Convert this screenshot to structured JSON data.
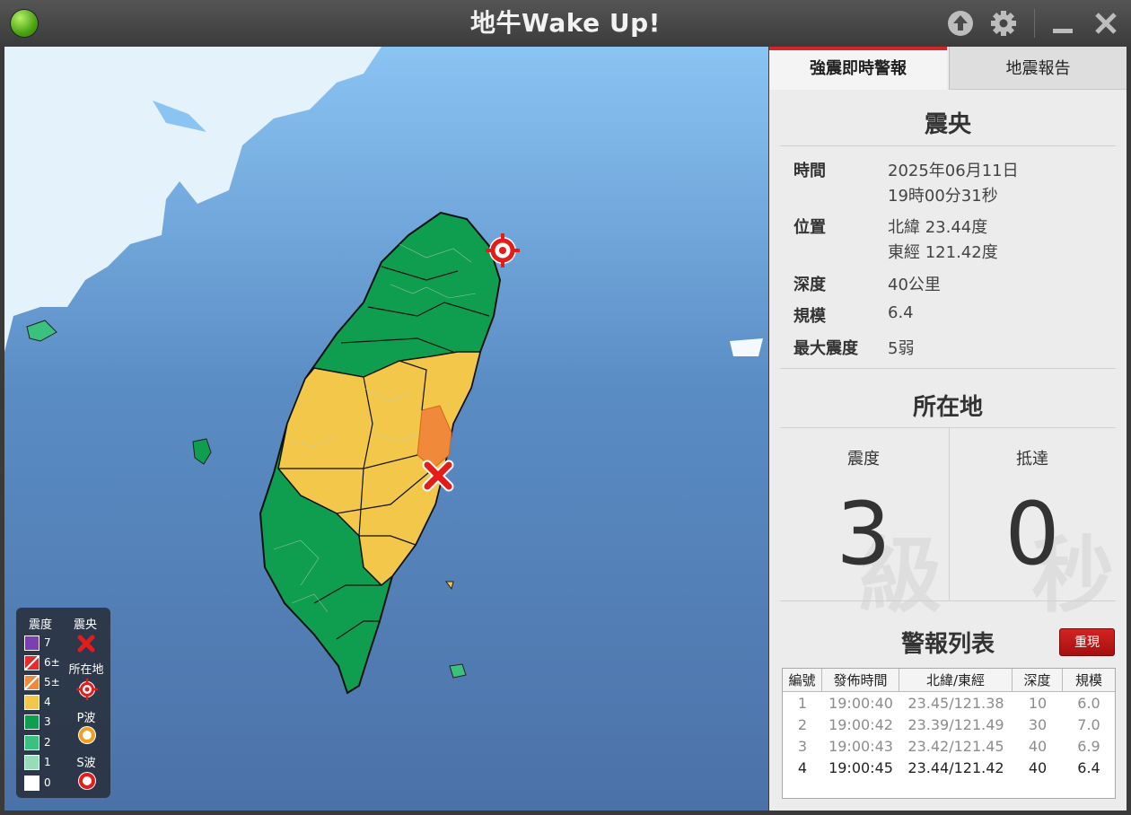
{
  "window": {
    "title": "地牛Wake Up!"
  },
  "tabs": [
    {
      "label": "強震即時警報"
    },
    {
      "label": "地震報告"
    }
  ],
  "epicenter": {
    "title": "震央",
    "time_label": "時間",
    "time_line1": "2025年06月11日",
    "time_line2": "19時00分31秒",
    "location_label": "位置",
    "lat": "北緯 23.44度",
    "lon": "東經 121.42度",
    "depth_label": "深度",
    "depth": "40公里",
    "magnitude_label": "規模",
    "magnitude": "6.4",
    "max_intensity_label": "最大震度",
    "max_intensity": "5弱"
  },
  "local": {
    "title": "所在地",
    "intensity_label": "震度",
    "intensity": "3",
    "intensity_unit": "級",
    "arrival_label": "抵達",
    "arrival": "0",
    "arrival_unit": "秒"
  },
  "alerts": {
    "title": "警報列表",
    "replay_label": "重現",
    "columns": [
      "編號",
      "發佈時間",
      "北緯/東經",
      "深度",
      "規模"
    ],
    "rows": [
      {
        "no": "1",
        "time": "19:00:40",
        "coord": "23.45/121.38",
        "depth": "10",
        "mag": "6.0"
      },
      {
        "no": "2",
        "time": "19:00:42",
        "coord": "23.39/121.49",
        "depth": "30",
        "mag": "7.0"
      },
      {
        "no": "3",
        "time": "19:00:43",
        "coord": "23.42/121.45",
        "depth": "40",
        "mag": "6.9"
      },
      {
        "no": "4",
        "time": "19:00:45",
        "coord": "23.44/121.42",
        "depth": "40",
        "mag": "6.4"
      }
    ]
  },
  "legend": {
    "intensity_header": "震度",
    "epicenter_header": "震央",
    "location_header": "所在地",
    "p_wave_header": "P波",
    "s_wave_header": "S波",
    "levels": [
      {
        "label": "7",
        "color": "#7a3fb0"
      },
      {
        "label": "6±",
        "color": "#e82a2a"
      },
      {
        "label": "5±",
        "color": "#f08a3a"
      },
      {
        "label": "4",
        "color": "#f2c74a"
      },
      {
        "label": "3",
        "color": "#0f9d4f"
      },
      {
        "label": "2",
        "color": "#3cc07e"
      },
      {
        "label": "1",
        "color": "#96dcb8"
      },
      {
        "label": "0",
        "color": "#ffffff"
      }
    ]
  },
  "colors": {
    "sea_top": "#8ac4f3",
    "sea_bottom": "#4b72a8",
    "land_mainland": "#e4f2fb",
    "accent": "#d3262a"
  }
}
